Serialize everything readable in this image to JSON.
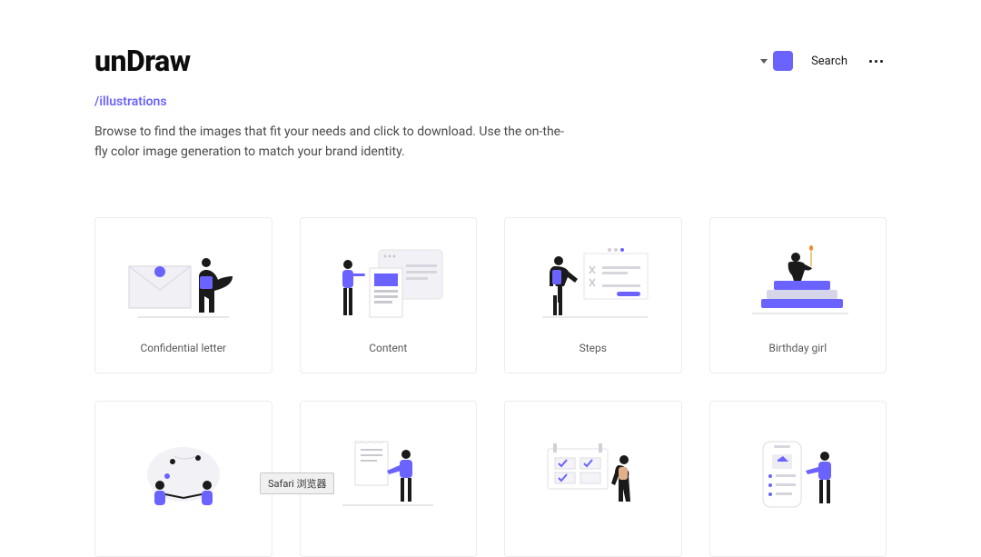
{
  "header": {
    "logo": "unDraw",
    "search_label": "Search",
    "accent_color": "#6b63ff"
  },
  "page": {
    "subtitle": "/illustrations",
    "description": "Browse to find the images that fit your needs and click to download. Use the on-the-fly color image generation to match your brand identity."
  },
  "cards": [
    {
      "title": "Confidential letter"
    },
    {
      "title": "Content"
    },
    {
      "title": "Steps"
    },
    {
      "title": "Birthday girl"
    },
    {
      "title": ""
    },
    {
      "title": ""
    },
    {
      "title": ""
    },
    {
      "title": ""
    }
  ],
  "tooltip": "Safari 浏览器"
}
